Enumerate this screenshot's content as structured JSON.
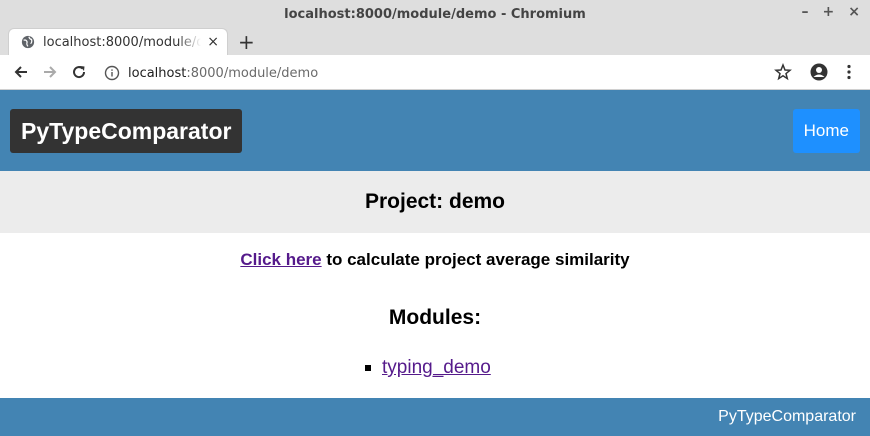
{
  "window": {
    "title": "localhost:8000/module/demo - Chromium",
    "controls": {
      "minimize": "–",
      "maximize": "+",
      "close": "×"
    }
  },
  "tab": {
    "label": "localhost:8000/module/demo",
    "close": "×"
  },
  "new_tab": "+",
  "address_bar": {
    "host": "localhost",
    "path": ":8000/module/demo"
  },
  "page": {
    "brand": "PyTypeComparator",
    "nav": {
      "home_label": "Home"
    },
    "project_heading": "Project: demo",
    "similarity": {
      "link_text": "Click here",
      "rest_text": " to calculate project average similarity"
    },
    "modules_heading": "Modules:",
    "modules": [
      {
        "name": "typing_demo"
      }
    ],
    "footer_text": "PyTypeComparator"
  },
  "colors": {
    "header_bg": "#4384b3",
    "brand_bg": "#333333",
    "home_bg": "#1e90ff",
    "band_bg": "#ececec",
    "link": "#551a8b"
  },
  "icons": [
    "back-arrow-icon",
    "forward-arrow-icon",
    "reload-icon",
    "info-icon",
    "star-icon",
    "account-icon",
    "menu-dots-icon",
    "globe-icon"
  ]
}
